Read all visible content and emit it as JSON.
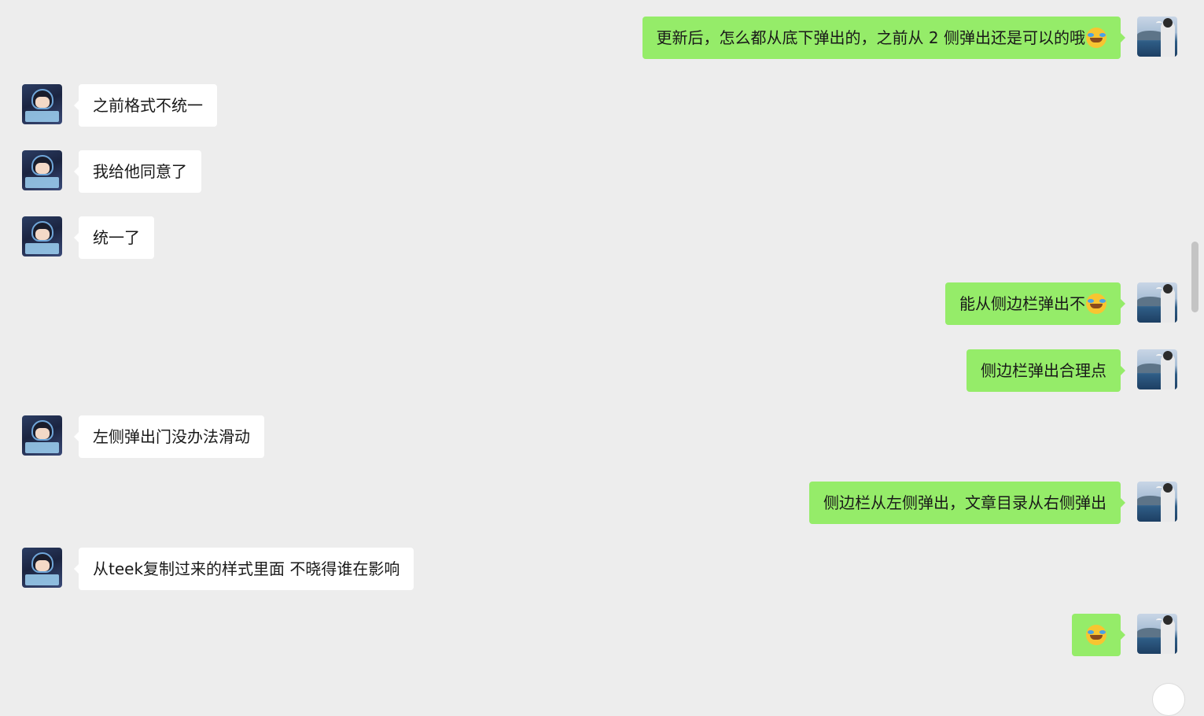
{
  "chat": {
    "messages": [
      {
        "side": "right",
        "text": "更新后，怎么都从底下弹出的，之前从 2 侧弹出还是可以的哦",
        "emoji": "laughing-crying-emoji"
      },
      {
        "side": "left",
        "text": "之前格式不统一"
      },
      {
        "side": "left",
        "text": "我给他同意了"
      },
      {
        "side": "left",
        "text": "统一了"
      },
      {
        "side": "right",
        "text": "能从侧边栏弹出不",
        "emoji": "laughing-crying-emoji"
      },
      {
        "side": "right",
        "text": "侧边栏弹出合理点"
      },
      {
        "side": "left",
        "text": "左侧弹出门没办法滑动"
      },
      {
        "side": "right",
        "text": "侧边栏从左侧弹出，文章目录从右侧弹出"
      },
      {
        "side": "left",
        "text": "从teek复制过来的样式里面 不晓得谁在影响"
      },
      {
        "side": "right",
        "text": "",
        "emoji": "laughing-crying-emoji"
      }
    ]
  },
  "colors": {
    "background": "#ededed",
    "self_bubble": "#95ec69",
    "other_bubble": "#ffffff",
    "text": "#191919"
  }
}
